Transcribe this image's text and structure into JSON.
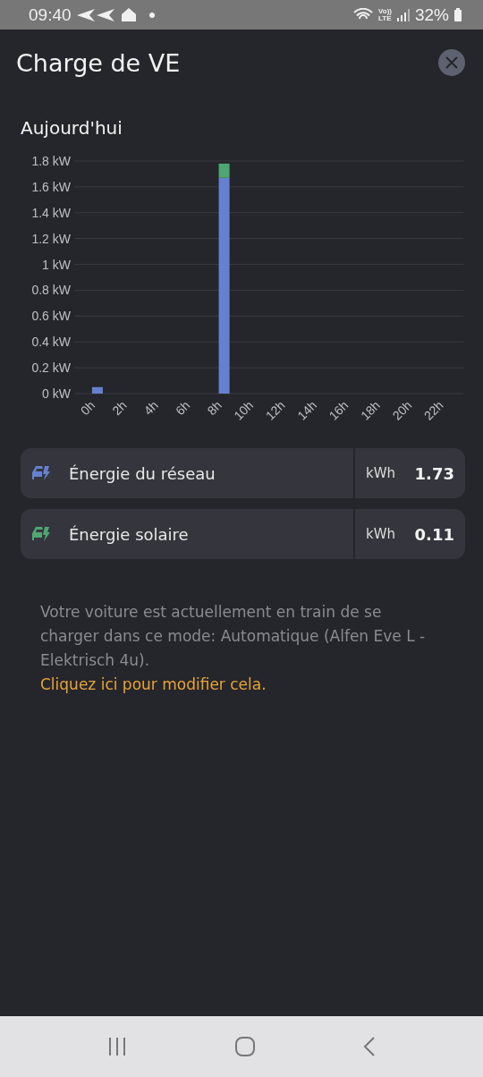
{
  "status_bar": {
    "time": "09:40",
    "network_top": "Vo))",
    "network_bottom": "LTE",
    "battery": "32%"
  },
  "dialog": {
    "title": "Charge de VE"
  },
  "section_title": "Aujourd'hui",
  "chart_data": {
    "type": "bar",
    "stacked": true,
    "grid": true,
    "categories": [
      "0h",
      "2h",
      "4h",
      "6h",
      "8h",
      "10h",
      "12h",
      "14h",
      "16h",
      "18h",
      "20h",
      "22h"
    ],
    "series": [
      {
        "color": "#6680d0",
        "values": [
          0.05,
          0,
          0,
          0,
          1.67,
          0,
          0,
          0,
          0,
          0,
          0,
          0
        ]
      },
      {
        "color": "#4fa672",
        "values": [
          0,
          0,
          0,
          0,
          0.11,
          0,
          0,
          0,
          0,
          0,
          0,
          0
        ]
      }
    ],
    "ylim": [
      0,
      1.8
    ],
    "yticks": [
      {
        "value": 0,
        "label": "0 kW"
      },
      {
        "value": 0.2,
        "label": "0.2 kW"
      },
      {
        "value": 0.4,
        "label": "0.4 kW"
      },
      {
        "value": 0.6,
        "label": "0.6 kW"
      },
      {
        "value": 0.8,
        "label": "0.8 kW"
      },
      {
        "value": 1,
        "label": "1 kW"
      },
      {
        "value": 1.2,
        "label": "1.2 kW"
      },
      {
        "value": 1.4,
        "label": "1.4 kW"
      },
      {
        "value": 1.6,
        "label": "1.6 kW"
      },
      {
        "value": 1.8,
        "label": "1.8 kW"
      }
    ]
  },
  "energy_rows": [
    {
      "label": "Énergie du réseau",
      "unit": "kWh",
      "value": "1.73",
      "color": "#6680d0"
    },
    {
      "label": "Énergie solaire",
      "unit": "kWh",
      "value": "0.11",
      "color": "#4fa672"
    }
  ],
  "description": "Votre voiture est actuellement en train de se charger dans ce mode: Automatique (Alfen Eve L - Elektrisch 4u).",
  "link": "Cliquez ici pour modifier cela."
}
